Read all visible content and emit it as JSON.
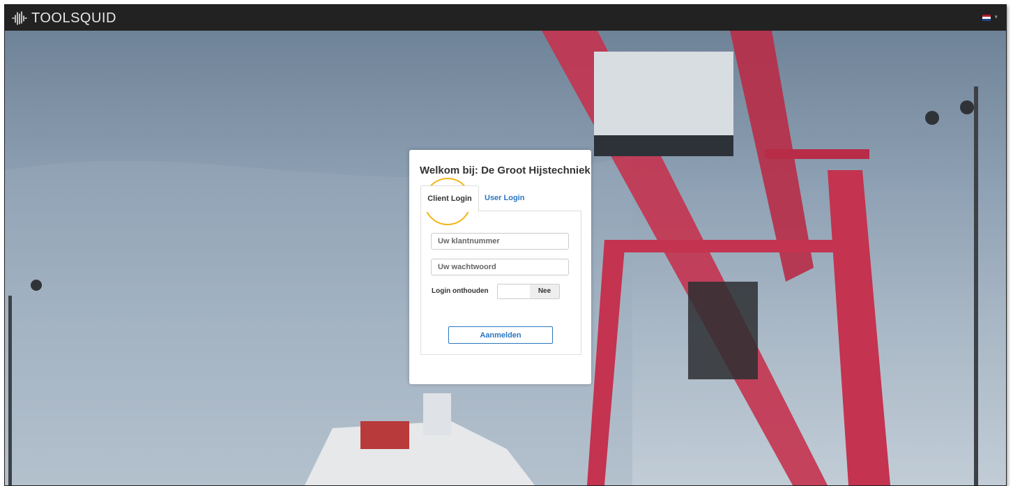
{
  "brand": {
    "name": "TOOLSQUID"
  },
  "language_flag": {
    "icon": "netherlands-flag-icon",
    "colors": [
      "#ae1c28",
      "#ffffff",
      "#21468b"
    ]
  },
  "login_panel": {
    "title": "Welkom bij: De Groot Hijstechniek",
    "tabs": [
      {
        "label": "Client Login",
        "active": true
      },
      {
        "label": "User Login",
        "active": false
      }
    ],
    "client_number": {
      "placeholder": "Uw klantnummer",
      "value": ""
    },
    "password": {
      "placeholder": "Uw wachtwoord",
      "value": ""
    },
    "remember": {
      "label": "Login onthouden",
      "toggle_value": "Nee"
    },
    "submit_label": "Aanmelden"
  },
  "colors": {
    "accent": "#2a76c2",
    "navbar": "#222222",
    "highlight": "#f3b414",
    "crane": "#c4334f"
  }
}
